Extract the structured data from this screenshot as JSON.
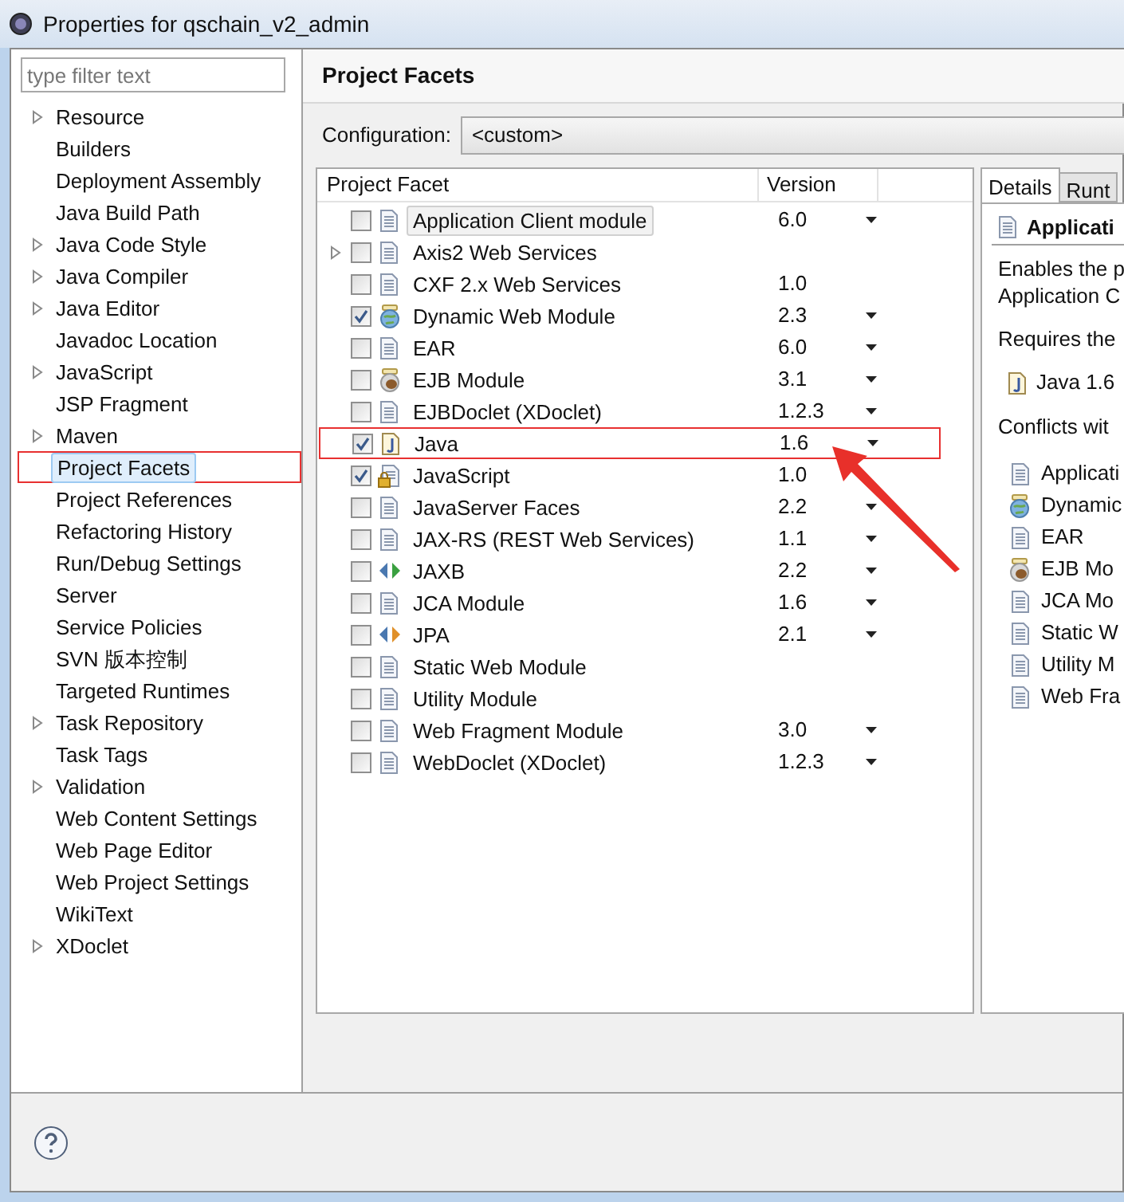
{
  "window": {
    "title": "Properties for qschain_v2_admin"
  },
  "filter": {
    "placeholder": "type filter text"
  },
  "sidebar": {
    "items": [
      {
        "label": "Resource",
        "expandable": true,
        "selected": false,
        "highlighted": false
      },
      {
        "label": "Builders",
        "expandable": false,
        "selected": false,
        "highlighted": false
      },
      {
        "label": "Deployment Assembly",
        "expandable": false,
        "selected": false,
        "highlighted": false
      },
      {
        "label": "Java Build Path",
        "expandable": false,
        "selected": false,
        "highlighted": false
      },
      {
        "label": "Java Code Style",
        "expandable": true,
        "selected": false,
        "highlighted": false
      },
      {
        "label": "Java Compiler",
        "expandable": true,
        "selected": false,
        "highlighted": false
      },
      {
        "label": "Java Editor",
        "expandable": true,
        "selected": false,
        "highlighted": false
      },
      {
        "label": "Javadoc Location",
        "expandable": false,
        "selected": false,
        "highlighted": false
      },
      {
        "label": "JavaScript",
        "expandable": true,
        "selected": false,
        "highlighted": false
      },
      {
        "label": "JSP Fragment",
        "expandable": false,
        "selected": false,
        "highlighted": false
      },
      {
        "label": "Maven",
        "expandable": true,
        "selected": false,
        "highlighted": false
      },
      {
        "label": "Project Facets",
        "expandable": false,
        "selected": true,
        "highlighted": true
      },
      {
        "label": "Project References",
        "expandable": false,
        "selected": false,
        "highlighted": false
      },
      {
        "label": "Refactoring History",
        "expandable": false,
        "selected": false,
        "highlighted": false
      },
      {
        "label": "Run/Debug Settings",
        "expandable": false,
        "selected": false,
        "highlighted": false
      },
      {
        "label": "Server",
        "expandable": false,
        "selected": false,
        "highlighted": false
      },
      {
        "label": "Service Policies",
        "expandable": false,
        "selected": false,
        "highlighted": false
      },
      {
        "label": "SVN 版本控制",
        "expandable": false,
        "selected": false,
        "highlighted": false
      },
      {
        "label": "Targeted Runtimes",
        "expandable": false,
        "selected": false,
        "highlighted": false
      },
      {
        "label": "Task Repository",
        "expandable": true,
        "selected": false,
        "highlighted": false
      },
      {
        "label": "Task Tags",
        "expandable": false,
        "selected": false,
        "highlighted": false
      },
      {
        "label": "Validation",
        "expandable": true,
        "selected": false,
        "highlighted": false
      },
      {
        "label": "Web Content Settings",
        "expandable": false,
        "selected": false,
        "highlighted": false
      },
      {
        "label": "Web Page Editor",
        "expandable": false,
        "selected": false,
        "highlighted": false
      },
      {
        "label": "Web Project Settings",
        "expandable": false,
        "selected": false,
        "highlighted": false
      },
      {
        "label": "WikiText",
        "expandable": false,
        "selected": false,
        "highlighted": false
      },
      {
        "label": "XDoclet",
        "expandable": true,
        "selected": false,
        "highlighted": false
      }
    ]
  },
  "page": {
    "title": "Project Facets",
    "configuration_label": "Configuration:",
    "configuration_value": "<custom>"
  },
  "table": {
    "columns": [
      "Project Facet",
      "Version"
    ],
    "rows": [
      {
        "name": "Application Client module",
        "version": "6.0",
        "kind": "doc",
        "checked": false,
        "expandable": false,
        "dropdown": true,
        "selected": true,
        "highlighted": false
      },
      {
        "name": "Axis2 Web Services",
        "kind": "doc",
        "checked": false,
        "expandable": true,
        "dropdown": false,
        "selected": false,
        "highlighted": false
      },
      {
        "name": "CXF 2.x Web Services",
        "version": "1.0",
        "kind": "doc",
        "checked": false,
        "expandable": false,
        "dropdown": false,
        "selected": false,
        "highlighted": false
      },
      {
        "name": "Dynamic Web Module",
        "version": "2.3",
        "kind": "web",
        "checked": true,
        "expandable": false,
        "dropdown": true,
        "selected": false,
        "highlighted": false
      },
      {
        "name": "EAR",
        "version": "6.0",
        "kind": "doc",
        "checked": false,
        "expandable": false,
        "dropdown": true,
        "selected": false,
        "highlighted": false
      },
      {
        "name": "EJB Module",
        "version": "3.1",
        "kind": "bean",
        "checked": false,
        "expandable": false,
        "dropdown": true,
        "selected": false,
        "highlighted": false
      },
      {
        "name": "EJBDoclet (XDoclet)",
        "version": "1.2.3",
        "kind": "doc",
        "checked": false,
        "expandable": false,
        "dropdown": true,
        "selected": false,
        "highlighted": false
      },
      {
        "name": "Java",
        "version": "1.6",
        "kind": "java",
        "checked": true,
        "expandable": false,
        "dropdown": true,
        "selected": false,
        "highlighted": true
      },
      {
        "name": "JavaScript",
        "version": "1.0",
        "kind": "locked",
        "checked": true,
        "expandable": false,
        "dropdown": false,
        "selected": false,
        "highlighted": false
      },
      {
        "name": "JavaServer Faces",
        "version": "2.2",
        "kind": "doc",
        "checked": false,
        "expandable": false,
        "dropdown": true,
        "selected": false,
        "highlighted": false
      },
      {
        "name": "JAX-RS (REST Web Services)",
        "version": "1.1",
        "kind": "doc",
        "checked": false,
        "expandable": false,
        "dropdown": true,
        "selected": false,
        "highlighted": false
      },
      {
        "name": "JAXB",
        "version": "2.2",
        "kind": "green-arrows",
        "checked": false,
        "expandable": false,
        "dropdown": true,
        "selected": false,
        "highlighted": false
      },
      {
        "name": "JCA Module",
        "version": "1.6",
        "kind": "doc",
        "checked": false,
        "expandable": false,
        "dropdown": true,
        "selected": false,
        "highlighted": false
      },
      {
        "name": "JPA",
        "version": "2.1",
        "kind": "orange-arrows",
        "checked": false,
        "expandable": false,
        "dropdown": true,
        "selected": false,
        "highlighted": false
      },
      {
        "name": "Static Web Module",
        "kind": "doc",
        "checked": false,
        "expandable": false,
        "dropdown": false,
        "selected": false,
        "highlighted": false
      },
      {
        "name": "Utility Module",
        "kind": "doc",
        "checked": false,
        "expandable": false,
        "dropdown": false,
        "selected": false,
        "highlighted": false
      },
      {
        "name": "Web Fragment Module",
        "version": "3.0",
        "kind": "doc",
        "checked": false,
        "expandable": false,
        "dropdown": true,
        "selected": false,
        "highlighted": false
      },
      {
        "name": "WebDoclet (XDoclet)",
        "version": "1.2.3",
        "kind": "doc",
        "checked": false,
        "expandable": false,
        "dropdown": true,
        "selected": false,
        "highlighted": false
      }
    ]
  },
  "details": {
    "tabs": [
      {
        "label": "Details",
        "selected": true
      },
      {
        "label": "Runt",
        "selected": false
      }
    ],
    "title": {
      "text": "Applicati",
      "kind": "doc"
    },
    "description_lines": [
      "Enables the p",
      "Application C"
    ],
    "requires_label": "Requires the",
    "requires": [
      {
        "name": "Java 1.6",
        "kind": "java"
      }
    ],
    "conflicts_label": "Conflicts wit",
    "conflicts": [
      {
        "name": "Applicati",
        "kind": "doc"
      },
      {
        "name": "Dynamic",
        "kind": "web"
      },
      {
        "name": "EAR",
        "kind": "doc"
      },
      {
        "name": "EJB Mo",
        "kind": "bean"
      },
      {
        "name": "JCA Mo",
        "kind": "doc"
      },
      {
        "name": "Static W",
        "kind": "doc"
      },
      {
        "name": "Utility M",
        "kind": "doc"
      },
      {
        "name": "Web Fra",
        "kind": "doc"
      }
    ]
  }
}
